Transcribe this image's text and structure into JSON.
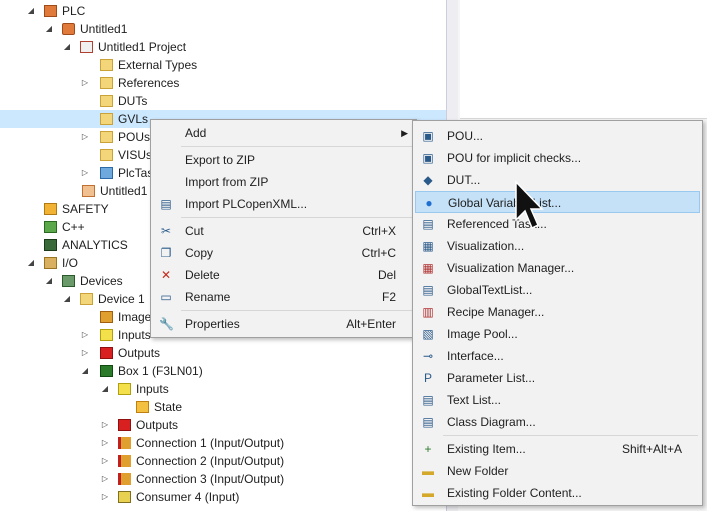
{
  "tree": [
    {
      "label": "PLC",
      "icon": "plc-icon",
      "expander": "open"
    },
    {
      "label": "Untitled1",
      "icon": "plc-project-icon",
      "expander": "open"
    },
    {
      "label": "Untitled1 Project",
      "icon": "project-icon",
      "expander": "open"
    },
    {
      "label": "External Types",
      "icon": "folder-icon",
      "expander": ""
    },
    {
      "label": "References",
      "icon": "folder-icon",
      "expander": "closed"
    },
    {
      "label": "DUTs",
      "icon": "folder-icon",
      "expander": ""
    },
    {
      "label": "GVLs",
      "icon": "folder-icon",
      "expander": "",
      "selected": true
    },
    {
      "label": "POUs",
      "icon": "folder-icon",
      "expander": "closed"
    },
    {
      "label": "VISUs",
      "icon": "folder-icon",
      "expander": ""
    },
    {
      "label": "PlcTas",
      "icon": "task-icon",
      "expander": "closed"
    },
    {
      "label": "Untitled1",
      "icon": "instance-icon",
      "expander": ""
    },
    {
      "label": "SAFETY",
      "icon": "safety-icon",
      "expander": ""
    },
    {
      "label": "C++",
      "icon": "cpp-icon",
      "expander": ""
    },
    {
      "label": "ANALYTICS",
      "icon": "analytics-icon",
      "expander": ""
    },
    {
      "label": "I/O",
      "icon": "io-icon",
      "expander": "open"
    },
    {
      "label": "Devices",
      "icon": "devices-icon",
      "expander": "open"
    },
    {
      "label": "Device 1",
      "icon": "device-icon",
      "expander": "open"
    },
    {
      "label": "Image",
      "icon": "image-icon",
      "expander": ""
    },
    {
      "label": "Inputs",
      "icon": "inputs-icon",
      "expander": "closed"
    },
    {
      "label": "Outputs",
      "icon": "outputs-icon",
      "expander": "closed"
    },
    {
      "label": "Box 1 (F3LN01)",
      "icon": "box-icon",
      "expander": "open"
    },
    {
      "label": "Inputs",
      "icon": "inputs-icon",
      "expander": "open"
    },
    {
      "label": "State",
      "icon": "state-icon",
      "expander": ""
    },
    {
      "label": "Outputs",
      "icon": "outputs-icon",
      "expander": "closed"
    },
    {
      "label": "Connection 1 (Input/Output)",
      "icon": "connection-icon",
      "expander": "closed"
    },
    {
      "label": "Connection 2 (Input/Output)",
      "icon": "connection-icon",
      "expander": "closed"
    },
    {
      "label": "Connection 3 (Input/Output)",
      "icon": "connection-icon",
      "expander": "closed"
    },
    {
      "label": "Consumer 4 (Input)",
      "icon": "consumer-icon",
      "expander": "closed"
    }
  ],
  "context_menu": {
    "items": [
      {
        "label": "Add",
        "shortcut": "",
        "icon": "",
        "submenu": true
      },
      {
        "separator": true
      },
      {
        "label": "Export to ZIP",
        "shortcut": "",
        "icon": ""
      },
      {
        "label": "Import from ZIP",
        "shortcut": "",
        "icon": ""
      },
      {
        "label": "Import PLCopenXML...",
        "shortcut": "",
        "icon": "import-icon"
      },
      {
        "separator": true
      },
      {
        "label": "Cut",
        "shortcut": "Ctrl+X",
        "icon": "scissors-icon"
      },
      {
        "label": "Copy",
        "shortcut": "Ctrl+C",
        "icon": "copy-icon"
      },
      {
        "label": "Delete",
        "shortcut": "Del",
        "icon": "delete-icon"
      },
      {
        "label": "Rename",
        "shortcut": "F2",
        "icon": "rename-icon"
      },
      {
        "separator": true
      },
      {
        "label": "Properties",
        "shortcut": "Alt+Enter",
        "icon": "wrench-icon"
      }
    ]
  },
  "add_submenu": {
    "items": [
      {
        "label": "POU...",
        "shortcut": "",
        "icon": "pou-icon"
      },
      {
        "label": "POU for implicit checks...",
        "shortcut": "",
        "icon": "pou-icon"
      },
      {
        "label": "DUT...",
        "shortcut": "",
        "icon": "dut-icon"
      },
      {
        "label": "Global Variable List...",
        "shortcut": "",
        "icon": "globe-icon",
        "highlighted": true
      },
      {
        "label": "Referenced Task...",
        "shortcut": "",
        "icon": "task-icon"
      },
      {
        "label": "Visualization...",
        "shortcut": "",
        "icon": "visualization-icon"
      },
      {
        "label": "Visualization Manager...",
        "shortcut": "",
        "icon": "visu-manager-icon"
      },
      {
        "label": "GlobalTextList...",
        "shortcut": "",
        "icon": "textlist-icon"
      },
      {
        "label": "Recipe Manager...",
        "shortcut": "",
        "icon": "recipe-icon"
      },
      {
        "label": "Image Pool...",
        "shortcut": "",
        "icon": "imagepool-icon"
      },
      {
        "label": "Interface...",
        "shortcut": "",
        "icon": "interface-icon"
      },
      {
        "label": "Parameter List...",
        "shortcut": "",
        "icon": "parameter-icon"
      },
      {
        "label": "Text List...",
        "shortcut": "",
        "icon": "textlist-icon"
      },
      {
        "label": "Class Diagram...",
        "shortcut": "",
        "icon": "class-diagram-icon"
      },
      {
        "separator": true
      },
      {
        "label": "Existing Item...",
        "shortcut": "Shift+Alt+A",
        "icon": "existing-item-icon"
      },
      {
        "label": "New Folder",
        "shortcut": "",
        "icon": "new-folder-icon"
      },
      {
        "label": "Existing Folder Content...",
        "shortcut": "",
        "icon": "folder-icon"
      }
    ]
  },
  "colors": {
    "selection": "#cce8ff",
    "menu_bg": "#f2f2f2",
    "highlight": "#c5e1f8"
  }
}
